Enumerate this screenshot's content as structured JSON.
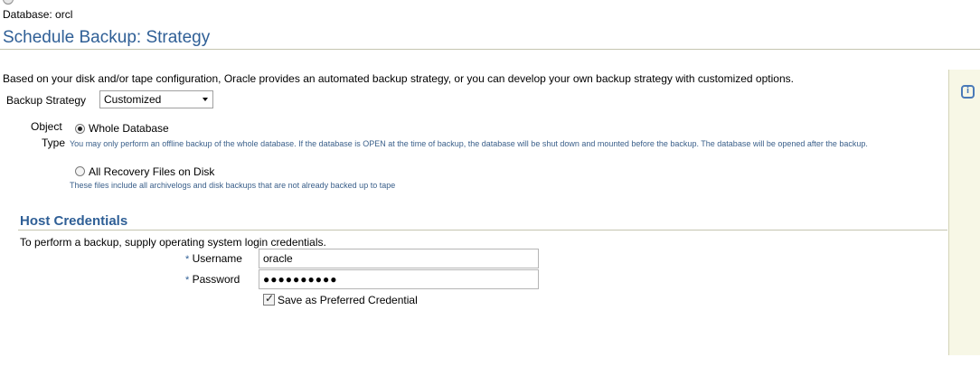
{
  "database_label": "Database: orcl",
  "page_title": "Schedule Backup: Strategy",
  "intro": "Based on your disk and/or tape configuration, Oracle provides an automated backup strategy, or you can develop your own backup strategy with customized options.",
  "backup_strategy": {
    "label": "Backup Strategy",
    "selected": "Customized"
  },
  "object_type": {
    "label_line1": "Object",
    "label_line2": "Type",
    "options": [
      {
        "label": "Whole Database",
        "checked": true,
        "help": "You may only perform an offline backup of the whole database. If the database is OPEN at the time of backup, the database will be shut down and mounted before the backup. The database will be opened after the backup."
      },
      {
        "label": "All Recovery Files on Disk",
        "checked": false,
        "help": "These files include all archivelogs and disk backups that are not already backed up to tape"
      }
    ]
  },
  "host_credentials": {
    "title": "Host Credentials",
    "intro": "To perform a backup, supply operating system login credentials.",
    "required_mark": "*",
    "username_label": "Username",
    "username_value": "oracle",
    "password_label": "Password",
    "password_value": "●●●●●●●●●●",
    "save_label": "Save as Preferred Credential",
    "save_checked": true
  },
  "icons": {
    "side_panel": "info-icon"
  },
  "colors": {
    "title": "#2f5f96",
    "help_text": "#3a5f8a",
    "side_panel_bg": "#f7f7e6"
  }
}
